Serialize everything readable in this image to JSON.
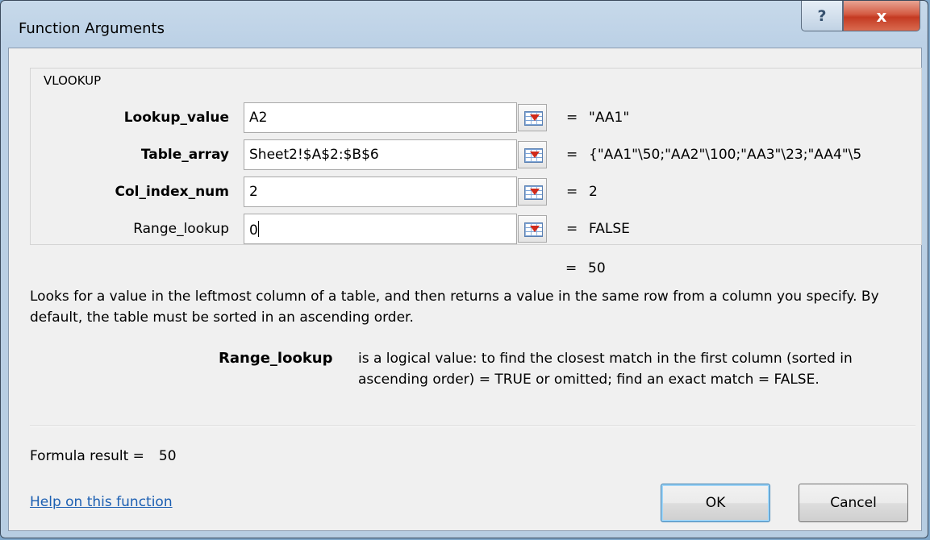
{
  "window": {
    "title": "Function Arguments",
    "help_button_label": "?",
    "close_button_label": "x"
  },
  "function": {
    "name": "VLOOKUP",
    "arguments": [
      {
        "label": "Lookup_value",
        "bold": true,
        "value": "A2",
        "result": "\"AA1\""
      },
      {
        "label": "Table_array",
        "bold": true,
        "value": "Sheet2!$A$2:$B$6",
        "result": "{\"AA1\"\\50;\"AA2\"\\100;\"AA3\"\\23;\"AA4\"\\5"
      },
      {
        "label": "Col_index_num",
        "bold": true,
        "value": "2",
        "result": "2"
      },
      {
        "label": "Range_lookup",
        "bold": false,
        "value": "0",
        "result": "FALSE"
      }
    ],
    "equals": "=",
    "result": "50",
    "description": "Looks for a value in the leftmost column of a table, and then returns a value in the same row from a column you specify. By default, the table must be sorted in an ascending order.",
    "arg_description": {
      "name": "Range_lookup",
      "text": "is a logical value: to find the closest match in the first column (sorted in ascending order) = TRUE or omitted; find an exact match = FALSE."
    }
  },
  "footer": {
    "formula_result_label": "Formula result =",
    "formula_result_value": "50",
    "help_link": "Help on this function",
    "ok_label": "OK",
    "cancel_label": "Cancel"
  }
}
